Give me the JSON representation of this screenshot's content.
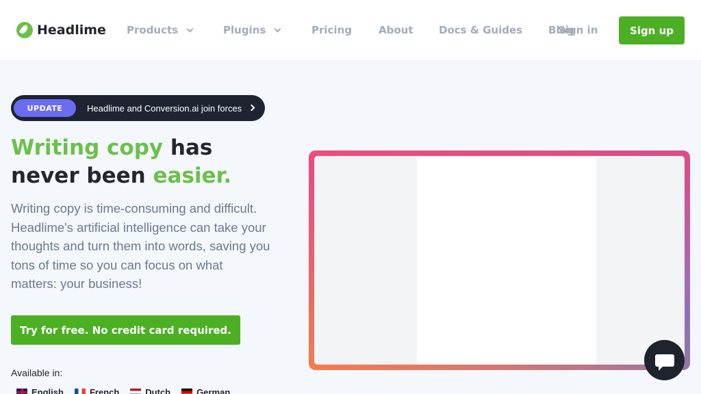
{
  "brand": {
    "name": "Headlime",
    "green": "#6cc04a",
    "button_green": "#4caf24",
    "icon": "leaf-logo-icon"
  },
  "nav": {
    "items": [
      {
        "label": "Products",
        "dropdown": true
      },
      {
        "label": "Plugins",
        "dropdown": true
      },
      {
        "label": "Pricing"
      },
      {
        "label": "About"
      },
      {
        "label": "Docs & Guides"
      },
      {
        "label": "Blog"
      }
    ],
    "signin_label": "Sign in",
    "signup_label": "Sign up"
  },
  "hero": {
    "update_badge": "UPDATE",
    "update_text": "Headlime and Conversion.ai join forces",
    "headline": {
      "part1": "Writing copy",
      "part2": " has never been ",
      "part3": "easier."
    },
    "description": "Writing copy is time-consuming and difficult. Headlime's artificial intelligence can take your thoughts and turn them into words, saving you tons of time so you can focus on what matters: your business!",
    "cta_label": "Try for free. No credit card required.",
    "available_label": "Available in:",
    "languages": [
      {
        "label": "English",
        "flag": "uk-flag-icon"
      },
      {
        "label": "French",
        "flag": "france-flag-icon"
      },
      {
        "label": "Dutch",
        "flag": "netherlands-flag-icon"
      },
      {
        "label": "German",
        "flag": "germany-flag-icon"
      }
    ]
  },
  "chat": {
    "icon": "chat-bubble-icon"
  }
}
